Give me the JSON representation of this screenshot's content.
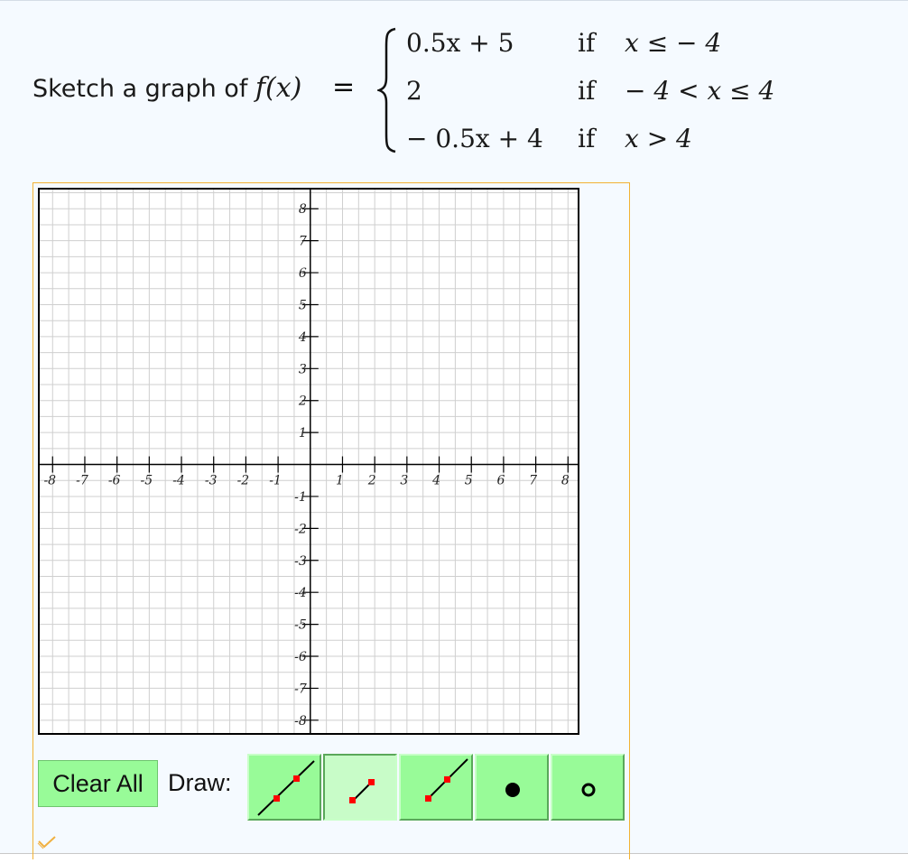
{
  "question": {
    "prompt_text": "Sketch a graph of ",
    "function_name": "f(x)",
    "equals": "=",
    "cases": [
      {
        "expr": "0.5x + 5",
        "if": "if",
        "cond": "x ≤ − 4"
      },
      {
        "expr": "2",
        "if": "if",
        "cond": "− 4 < x ≤ 4"
      },
      {
        "expr": "− 0.5x + 4",
        "if": "if",
        "cond": "x > 4"
      }
    ]
  },
  "graph": {
    "x_ticks": [
      "-8",
      "-7",
      "-6",
      "-5",
      "-4",
      "-3",
      "-2",
      "-1",
      "1",
      "2",
      "3",
      "4",
      "5",
      "6",
      "7",
      "8"
    ],
    "y_ticks": [
      "8",
      "7",
      "6",
      "5",
      "4",
      "3",
      "2",
      "1",
      "-1",
      "-2",
      "-3",
      "-4",
      "-5",
      "-6",
      "-7",
      "-8"
    ],
    "xlim": [
      -8.4,
      8.3
    ],
    "ylim": [
      -8.4,
      8.6
    ],
    "grid": true,
    "colors": {
      "grid": "#cfcfcf",
      "axis": "#000000",
      "frame": "#f2b233"
    }
  },
  "toolbar": {
    "clear_label": "Clear All",
    "draw_label": "Draw:",
    "tools": [
      {
        "name": "line",
        "selected": false
      },
      {
        "name": "segment",
        "selected": true
      },
      {
        "name": "ray",
        "selected": false
      },
      {
        "name": "closed-point",
        "selected": false
      },
      {
        "name": "open-point",
        "selected": false
      }
    ],
    "button_color": "#98fb98",
    "point_color": "#ff0000"
  }
}
